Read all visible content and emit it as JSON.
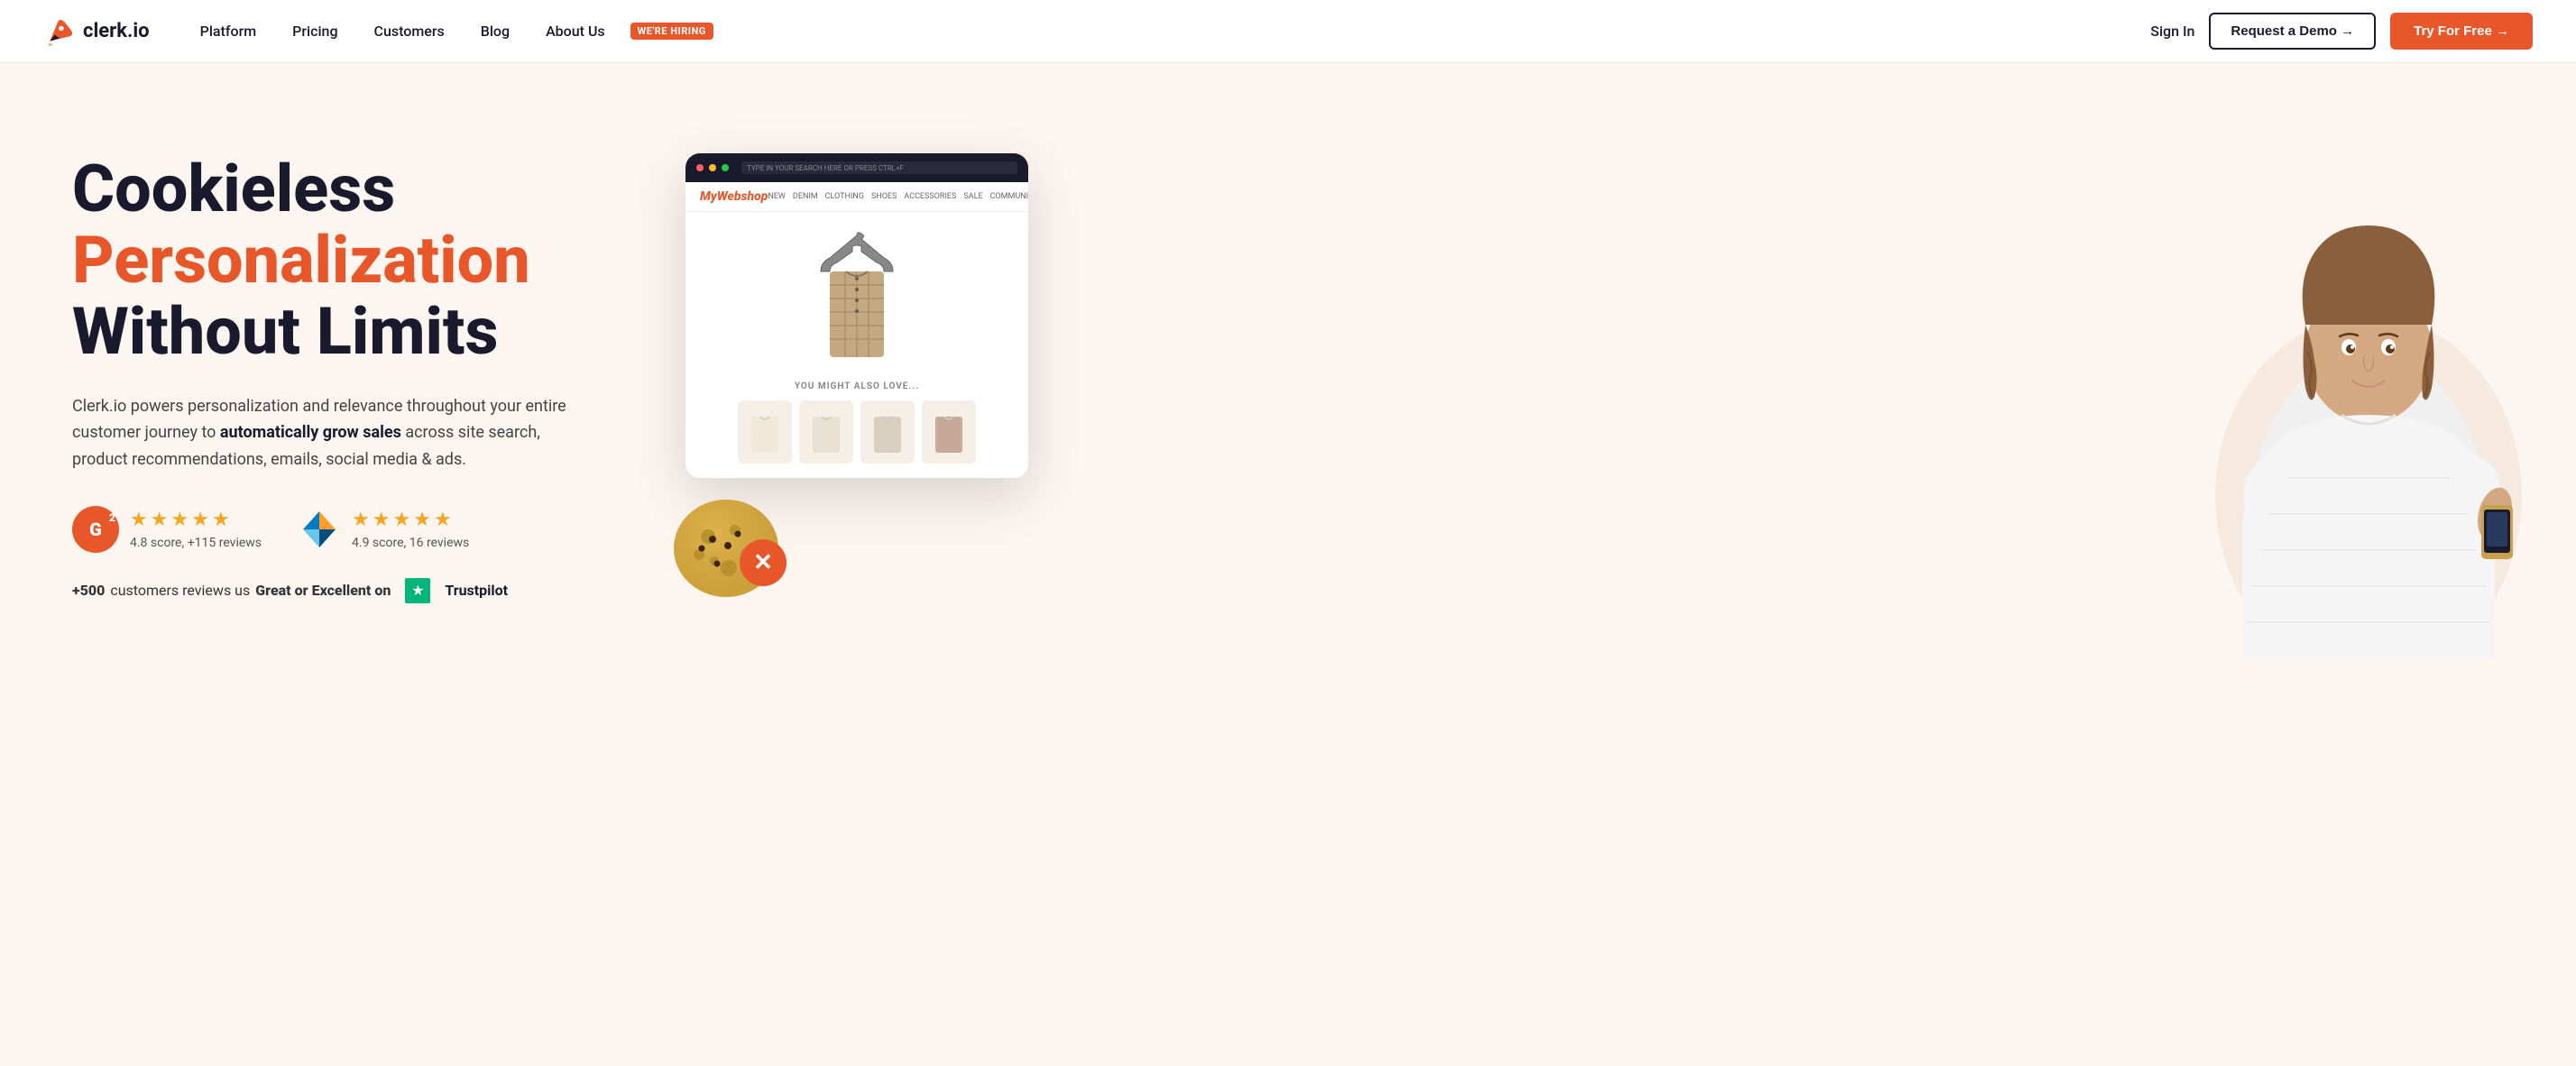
{
  "nav": {
    "logo_text": "clerk.io",
    "links": [
      {
        "id": "platform",
        "label": "Platform"
      },
      {
        "id": "pricing",
        "label": "Pricing"
      },
      {
        "id": "customers",
        "label": "Customers"
      },
      {
        "id": "blog",
        "label": "Blog"
      },
      {
        "id": "about",
        "label": "About Us"
      }
    ],
    "hiring_badge": "WE'RE HIRING",
    "signin": "Sign In",
    "demo_btn": "Request a Demo →",
    "try_btn": "Try For Free →"
  },
  "hero": {
    "title_line1": "Cookieless",
    "title_line2": "Personalization",
    "title_line3": "Without Limits",
    "subtitle_before": "Clerk.io powers personalization and relevance throughout your entire customer journey to ",
    "subtitle_bold": "automatically grow sales",
    "subtitle_after": " across site search, product recommendations, emails, social media & ads.",
    "ratings": {
      "g2_label": "G",
      "g2_sup": "2",
      "g2_stars": "★★★★★",
      "g2_score": "4.8 score, +115 reviews",
      "capterra_stars": "★★★★★",
      "capterra_score": "4.9 score, 16 reviews"
    },
    "trustpilot": {
      "prefix": "+500",
      "text": " customers reviews us ",
      "bold": "Great or Excellent on",
      "brand": "Trustpilot"
    }
  },
  "shop_card": {
    "brand": "MyWebshop",
    "nav_items": [
      "NEW",
      "DENIM",
      "CLOTHING",
      "SHOES",
      "ACCESSORIES",
      "SALE",
      "COMMUNITY"
    ],
    "also_love": "YOU MIGHT ALSO LOVE...",
    "search_placeholder": "TYPE IN YOUR SEARCH HERE OR PRESS CTRL+F"
  }
}
